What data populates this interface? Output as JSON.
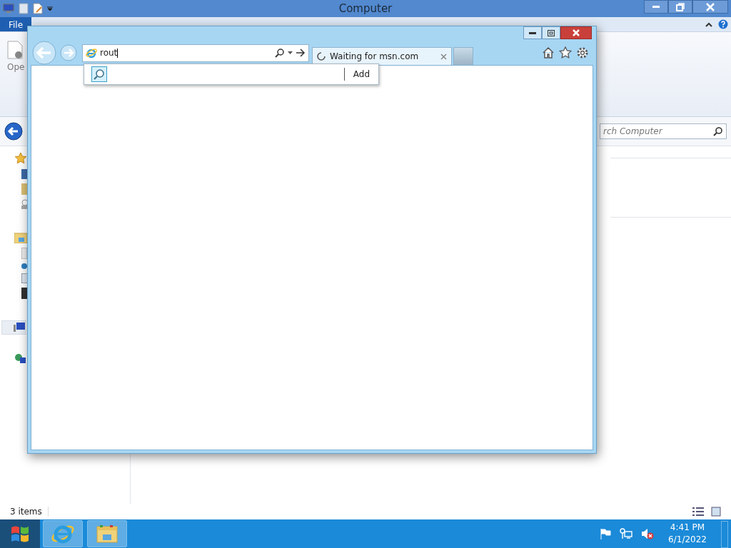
{
  "explorer": {
    "title": "Computer",
    "ribbon_tabs": [
      {
        "label": "File",
        "selected": true
      }
    ],
    "ribbon_button": "Ope",
    "search": {
      "placeholder": "rch Computer"
    },
    "status_bar": {
      "item_count": "3 items"
    }
  },
  "browser": {
    "address": {
      "value": "rout"
    },
    "suggestion": {
      "add_button": "Add"
    },
    "tab": {
      "title": "Waiting for msn.com"
    }
  },
  "taskbar": {
    "apps": [
      {
        "kind": "browser"
      },
      {
        "kind": "files"
      }
    ],
    "clock": {
      "time": "4:41 PM",
      "date": "6/1/2022"
    }
  }
}
